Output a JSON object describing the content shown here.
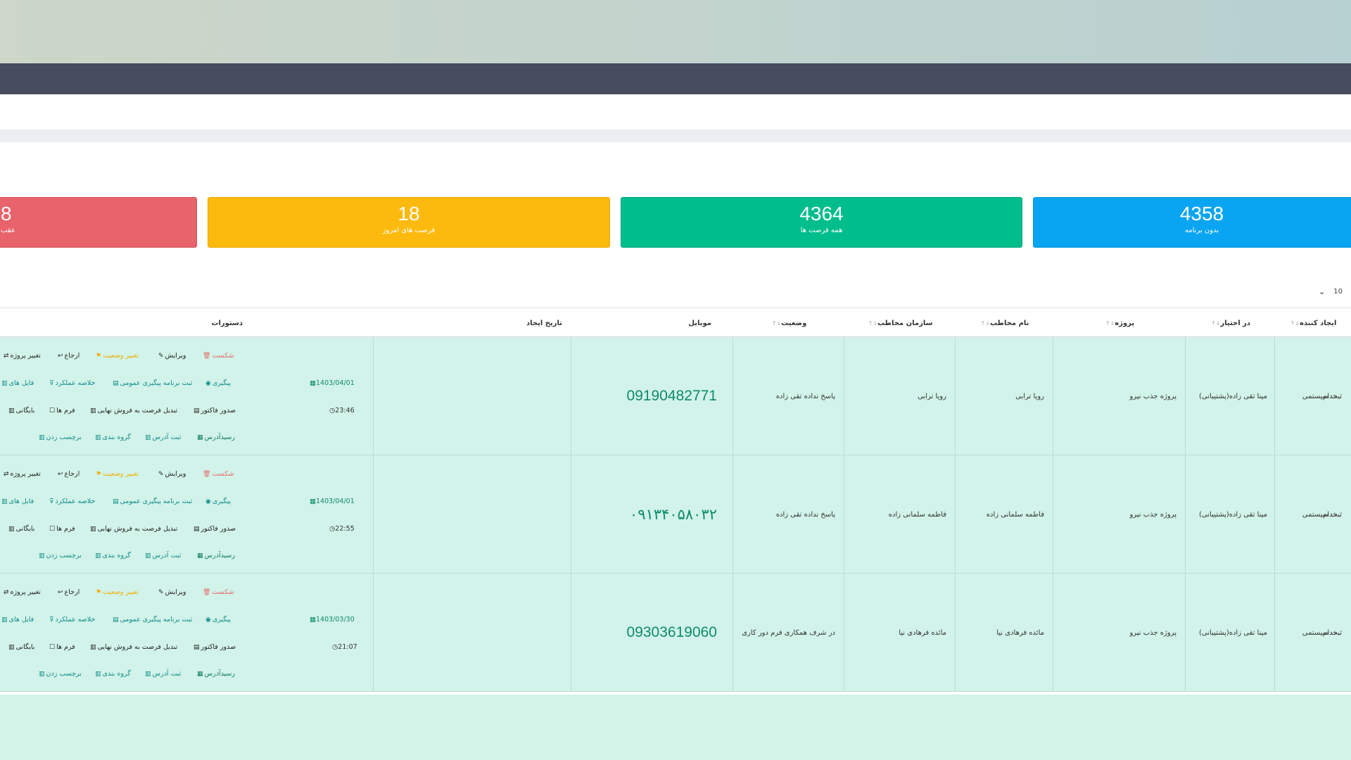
{
  "stats": [
    {
      "value": "4358",
      "label": "بدون برنامه"
    },
    {
      "value": "4364",
      "label": "همه فرصت ها"
    },
    {
      "value": "18",
      "label": "فرصت های امروز"
    },
    {
      "value": "8",
      "label": "عقب"
    }
  ],
  "pager": {
    "page_size": "10"
  },
  "table": {
    "headers": {
      "creator": "ایجاد کننده",
      "assignee": "در اختیار",
      "project": "پروژه",
      "contact_name": "نام مخاطب",
      "organization": "سازمان مخاطب",
      "status": "وضعیت",
      "mobile": "موبایل",
      "created": "تاریخ ایجاد",
      "commands": "دستورات"
    },
    "rows": [
      {
        "edge": "خدام",
        "creator": "ثبت سیستمی",
        "assignee": "مینا تقی زاده(پشتیبانی)",
        "project": "پروژه جذب نیرو",
        "contact_name": "رویا ترابی",
        "organization": "رویا ترابی",
        "status": "پاسخ نداده تقی زاده",
        "mobile": "09190482771",
        "date": "1403/04/01",
        "time": "23:46"
      },
      {
        "edge": "خدام",
        "creator": "ثبت سیستمی",
        "assignee": "مینا تقی زاده(پشتیبانی)",
        "project": "پروژه جذب نیرو",
        "contact_name": "فاطمه سلمانی زاده",
        "organization": "فاطمه سلمانی زاده",
        "status": "پاسخ نداده تقی زاده",
        "mobile": "۰۹۱۳۴۰۵۸۰۳۲",
        "date": "1403/04/01",
        "time": "22:55"
      },
      {
        "edge": "خدام",
        "creator": "ثبت سیستمی",
        "assignee": "مینا تقی زاده(پشتیبانی)",
        "project": "پروژه جذب نیرو",
        "contact_name": "مائده فرهادی نیا",
        "organization": "مائده فرهادی نیا",
        "status": "در شرف همکاری فرم دور کاری",
        "mobile": "09303619060",
        "date": "1403/03/30",
        "time": "21:07"
      }
    ],
    "actions": {
      "break": "شکست",
      "edit": "ویرایش",
      "change_status": "تغییر وضعیت",
      "return": "ارجاع",
      "change_project": "تغییر پروژه",
      "followup": "پیگیری",
      "general_followup": "ثبت برنامه پیگیری عمومی",
      "performance": "خلاصه عملکرد",
      "files": "فایل های",
      "invoice": "صدور فاکتور",
      "convert": "تبدیل فرصت به فروش نهایی",
      "forms": "فرم ها",
      "archive": "بایگانی",
      "receipt": "رسیدآدرس",
      "address": "ثبت آدرس",
      "group": "گروه بندی",
      "tag": "برچسب زدن"
    }
  },
  "colors": {
    "blue": "#0aa5f2",
    "green": "#00bd8c",
    "yellow": "#fdba0e",
    "red": "#e8636c",
    "row_bg": "#d2f3e9",
    "dark_bar": "#474c5e"
  }
}
